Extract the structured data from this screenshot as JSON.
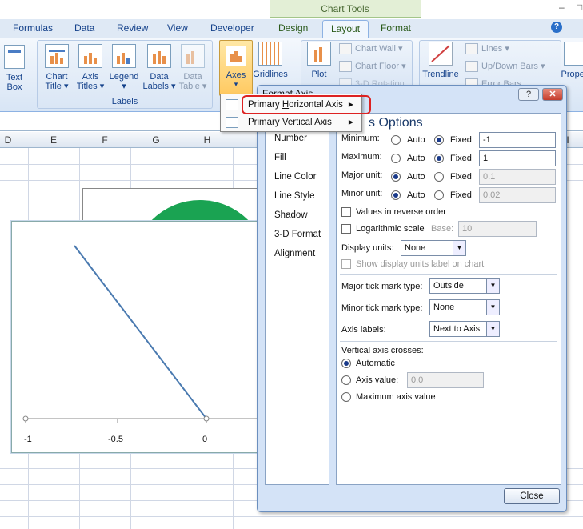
{
  "context_tab": "Chart Tools",
  "window_controls": {
    "minimize": "–",
    "restore": "□"
  },
  "tabs": [
    "Formulas",
    "Data",
    "Review",
    "View",
    "Developer",
    "Design",
    "Layout",
    "Format"
  ],
  "active_tab": "Layout",
  "help": "?",
  "ribbon": {
    "text_box": {
      "line1": "Text",
      "line2": "Box"
    },
    "labels_group": {
      "label": "Labels",
      "chart_title": {
        "line1": "Chart",
        "line2": "Title ▾"
      },
      "axis_titles": {
        "line1": "Axis",
        "line2": "Titles ▾"
      },
      "legend": {
        "line1": "Legend",
        "line2": "▾"
      },
      "data_labels": {
        "line1": "Data",
        "line2": "Labels ▾"
      },
      "data_table": {
        "line1": "Data",
        "line2": "Table ▾"
      }
    },
    "axes": {
      "label": "Axes",
      "arrow": "▾"
    },
    "gridlines": {
      "label": "Gridlines"
    },
    "plot": {
      "label": "Plot"
    },
    "chart_wall": "Chart Wall ▾",
    "chart_floor": "Chart Floor ▾",
    "rotation": "3-D Rotation",
    "trendline": "Trendline",
    "lines": "Lines ▾",
    "updown_bars": "Up/Down Bars ▾",
    "error_bars": "Error Bars",
    "properties": "Proper"
  },
  "columns": [
    "D",
    "E",
    "F",
    "G",
    "H",
    "I"
  ],
  "chart": {
    "tick_labels": [
      "-1",
      "-0.5",
      "0"
    ],
    "line": {
      "x1": -0.73,
      "x2": 0.0
    }
  },
  "axes_menu": {
    "item1": {
      "pre": "Primary ",
      "key": "H",
      "post": "orizontal Axis",
      "arrow": "▶"
    },
    "item2": {
      "pre": "Primary ",
      "key": "V",
      "post": "ertical Axis",
      "arrow": "▶"
    }
  },
  "dialog": {
    "title": "Format Axis",
    "help": "?",
    "close_x": "✕",
    "sidebar": [
      "Number",
      "Fill",
      "Line Color",
      "Line Style",
      "Shadow",
      "3-D Format",
      "Alignment"
    ],
    "panel_title": "s Options",
    "minimum": {
      "label": "Minimum:",
      "auto": "Auto",
      "fixed": "Fixed",
      "value": "-1"
    },
    "maximum": {
      "label": "Maximum:",
      "auto": "Auto",
      "fixed": "Fixed",
      "value": "1"
    },
    "major_unit": {
      "label": "Major unit:",
      "auto": "Auto",
      "fixed": "Fixed",
      "value": "0.1"
    },
    "minor_unit": {
      "label": "Minor unit:",
      "auto": "Auto",
      "fixed": "Fixed",
      "value": "0.02"
    },
    "values_reverse": "Values in reverse order",
    "log_scale": "Logarithmic scale",
    "base": {
      "label": "Base:",
      "value": "10"
    },
    "display_units": {
      "label": "Display units:",
      "value": "None"
    },
    "show_units_label": "Show display units label on chart",
    "major_tick": {
      "label": "Major tick mark type:",
      "value": "Outside"
    },
    "minor_tick": {
      "label": "Minor tick mark type:",
      "value": "None"
    },
    "axis_labels": {
      "label": "Axis labels:",
      "value": "Next to Axis"
    },
    "vertical_crosses": "Vertical axis crosses:",
    "automatic": "Automatic",
    "axis_value": {
      "label": "Axis value:",
      "value": "0.0"
    },
    "maximum_axis_value": "Maximum axis value",
    "close_button": "Close"
  }
}
